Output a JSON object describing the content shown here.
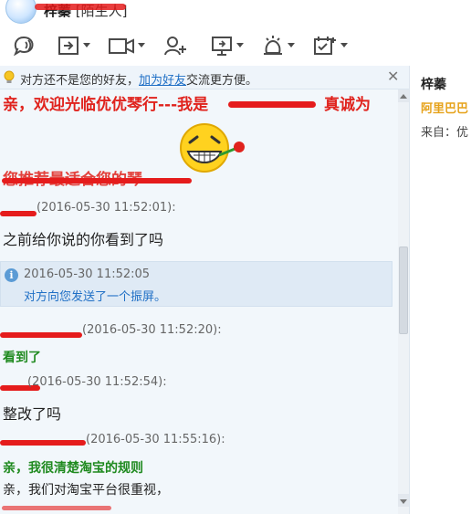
{
  "window": {
    "title_name": "梓蓁",
    "title_tag": "[陌生人]"
  },
  "toolbar": {
    "buttons": [
      {
        "icon": "voice-chat-icon",
        "has_menu": false
      },
      {
        "icon": "send-file-icon",
        "has_menu": true
      },
      {
        "icon": "video-call-icon",
        "has_menu": true
      },
      {
        "icon": "add-friend-icon",
        "has_menu": false
      },
      {
        "icon": "remote-desktop-icon",
        "has_menu": true
      },
      {
        "icon": "app-icon",
        "has_menu": true
      },
      {
        "icon": "calendar-add-icon",
        "has_menu": true
      }
    ]
  },
  "notice": {
    "prefix": "对方还不是您的好友，",
    "link": "加为好友",
    "suffix": "交流更方便。"
  },
  "messages": {
    "greeting_line1": "亲，欢迎光临优优琴行---我是",
    "greeting_line1_tail": "真诚为",
    "greeting_line2": "您推荐最适合您的琴",
    "m1_time": "(2016-05-30 11:52:01):",
    "m1_text": "之前给你说的你看到了吗",
    "sys_time": "2016-05-30 11:52:05",
    "sys_text": "对方向您发送了一个振屏。",
    "m2_time": "(2016-05-30 11:52:20):",
    "m2_text": "看到了",
    "m3_time": "(2016-05-30 11:52:54):",
    "m3_text": "整改了吗",
    "m4_time": "(2016-05-30 11:55:16):",
    "m4_text1": "亲，我很清楚淘宝的规则",
    "m4_text2": "亲，我们对淘宝平台很重视，"
  },
  "contact": {
    "name": "梓蓁",
    "shop": "阿里巴巴",
    "from": "来自：优"
  },
  "colors": {
    "accent_blue": "#1f6fc5",
    "greeting_red": "#e0231d",
    "seller_green": "#1f8a1f",
    "shop_orange": "#e6a21a"
  }
}
